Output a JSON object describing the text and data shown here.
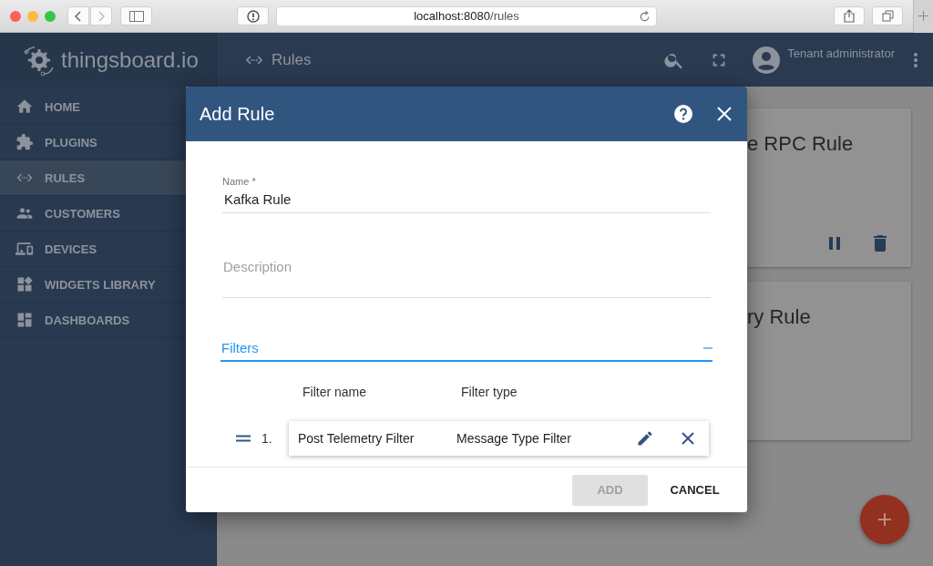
{
  "browser": {
    "url_host": "localhost:8080",
    "url_path": "/rules"
  },
  "app": {
    "logo": "thingsboard.io",
    "section": "Rules",
    "user": "Tenant administrator"
  },
  "sidebar": {
    "items": [
      {
        "label": "HOME",
        "selected": false
      },
      {
        "label": "PLUGINS",
        "selected": false
      },
      {
        "label": "RULES",
        "selected": true
      },
      {
        "label": "CUSTOMERS",
        "selected": false
      },
      {
        "label": "DEVICES",
        "selected": false
      },
      {
        "label": "WIDGETS LIBRARY",
        "selected": false
      },
      {
        "label": "DASHBOARDS",
        "selected": false
      }
    ]
  },
  "cards": [
    {
      "title": "e RPC Rule",
      "kind": "with-actions"
    },
    {
      "title": "ry Rule",
      "kind": "plain"
    }
  ],
  "dialog": {
    "title": "Add Rule",
    "name_field": {
      "label": "Name *",
      "value": "Kafka Rule"
    },
    "description_field": {
      "placeholder": "Description"
    },
    "filters": {
      "label": "Filters",
      "expanded": true,
      "columns": [
        "Filter name",
        "Filter type"
      ],
      "rows": [
        {
          "index": "1.",
          "name": "Post Telemetry Filter",
          "type": "Message Type Filter"
        }
      ]
    },
    "buttons": [
      {
        "label": "ADD",
        "disabled": true
      },
      {
        "label": "CANCEL",
        "disabled": false
      }
    ]
  }
}
